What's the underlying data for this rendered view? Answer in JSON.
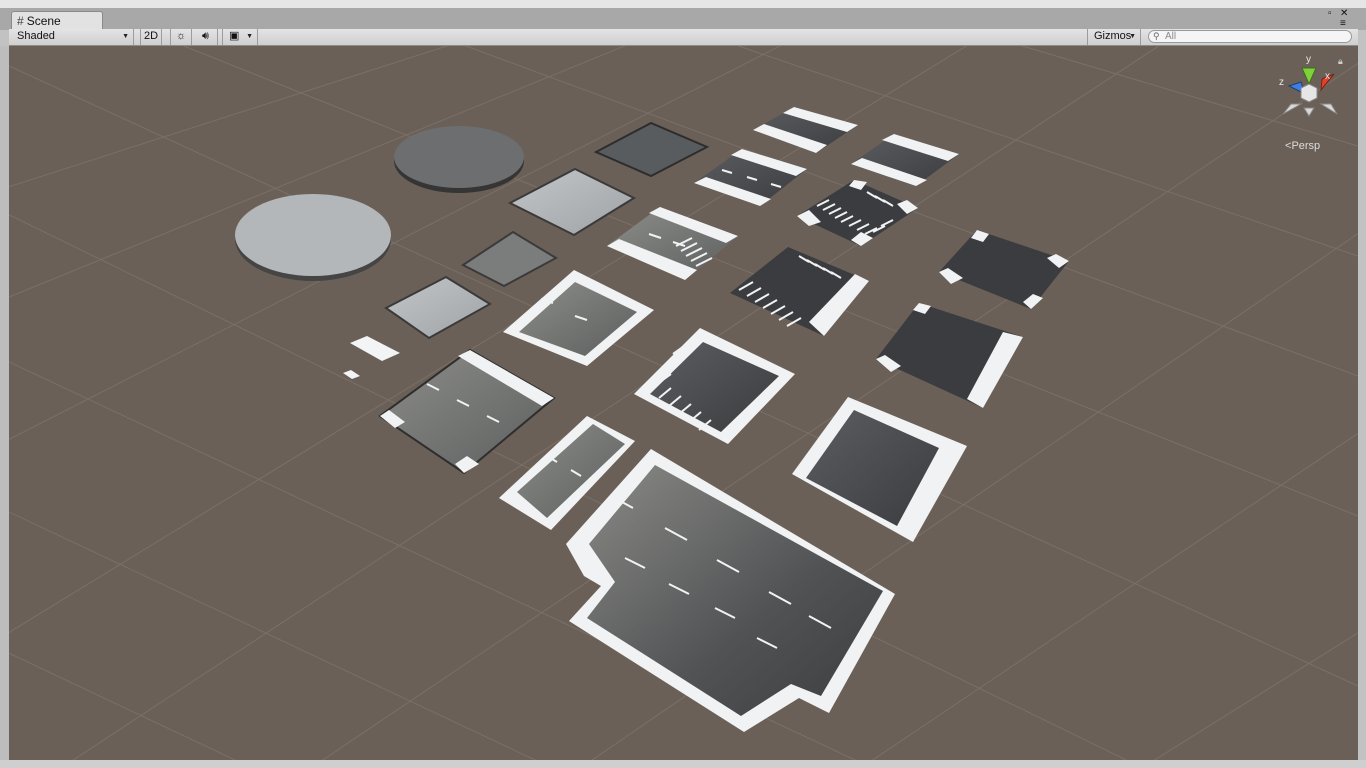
{
  "window": {
    "tab_label": "Scene",
    "tab_icon": "grid-hash-icon",
    "controls": {
      "maximize": "▫",
      "close": "✕",
      "menu": "≡"
    }
  },
  "toolbar": {
    "shading_mode": "Shaded",
    "toggle_2d": "2D",
    "lighting_icon": "sun-icon",
    "audio_icon": "speaker-icon",
    "effects_icon": "image-icon",
    "gizmos_label": "Gizmos",
    "search_placeholder": "All"
  },
  "viewport": {
    "projection_label": "Persp",
    "axes": {
      "y": "y",
      "x": "x",
      "z": "z"
    },
    "colors": {
      "background": "#6b6057",
      "grid": "#7c7169",
      "x_axis": "#e0412a",
      "y_axis": "#7fd13c",
      "z_axis": "#3d7fe0"
    }
  }
}
